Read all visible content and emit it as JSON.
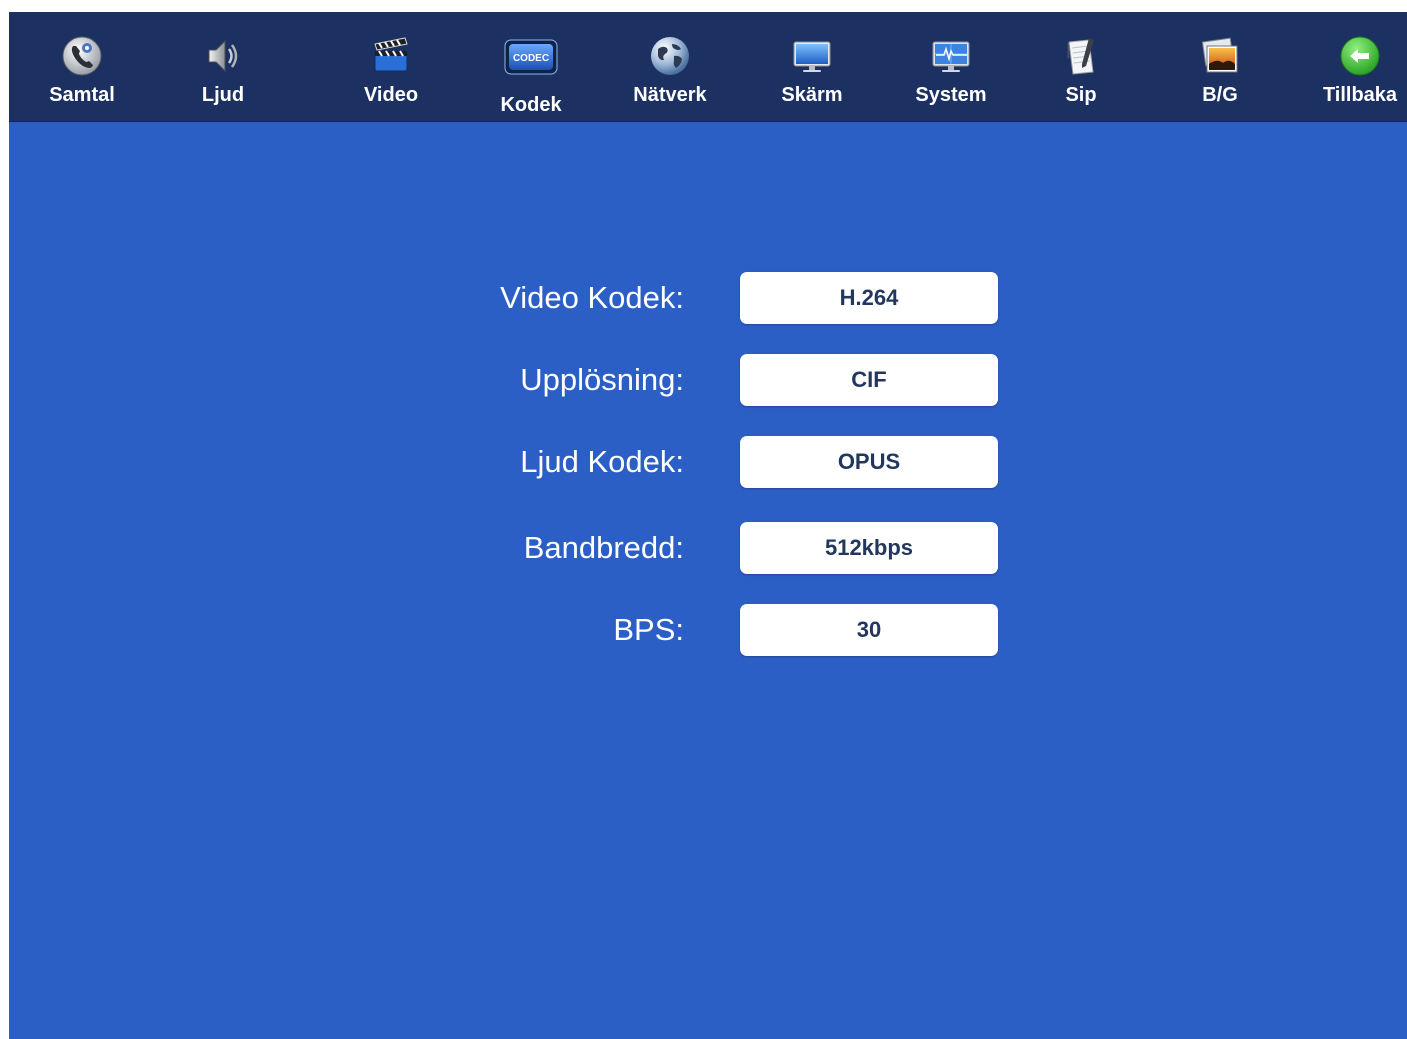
{
  "nav": {
    "items": [
      {
        "label": "Samtal",
        "icon": "phone-settings-icon"
      },
      {
        "label": "Ljud",
        "icon": "speaker-icon"
      },
      {
        "label": "Video",
        "icon": "clapperboard-icon"
      },
      {
        "label": "Kodek",
        "icon": "codec-icon",
        "active": true
      },
      {
        "label": "Nätverk",
        "icon": "globe-icon"
      },
      {
        "label": "Skärm",
        "icon": "monitor-icon"
      },
      {
        "label": "System",
        "icon": "system-monitor-icon"
      },
      {
        "label": "Sip",
        "icon": "notepad-icon"
      },
      {
        "label": "B/G",
        "icon": "background-image-icon"
      },
      {
        "label": "Tillbaka",
        "icon": "back-arrow-icon"
      }
    ],
    "codec_icon_text": "CODEC"
  },
  "form": {
    "rows": [
      {
        "label": "Video Kodek:",
        "value": "H.264"
      },
      {
        "label": "Upplösning:",
        "value": "CIF"
      },
      {
        "label": "Ljud Kodek:",
        "value": "OPUS"
      },
      {
        "label": "Bandbredd:",
        "value": "512kbps"
      },
      {
        "label": "BPS:",
        "value": "30"
      }
    ]
  },
  "colors": {
    "background": "#2c5fc6",
    "topbar": "#1c3161",
    "box": "#ffffff",
    "box_text": "#23375e",
    "back_button": "#3fbf3a"
  }
}
